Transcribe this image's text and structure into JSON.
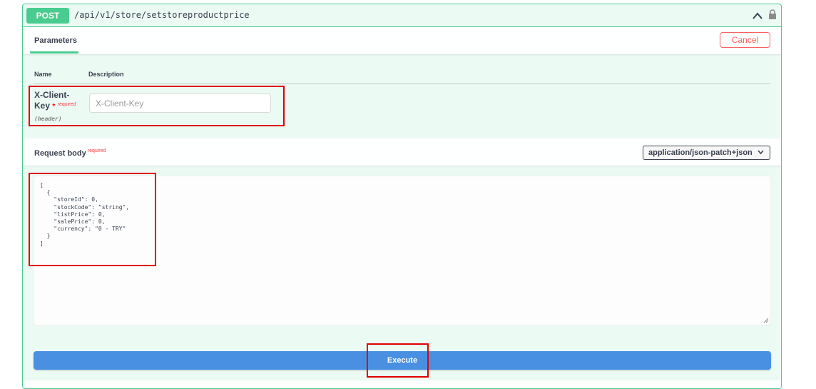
{
  "operation": {
    "method": "POST",
    "path": "/api/v1/store/setstoreproductprice"
  },
  "tabs": {
    "parameters_label": "Parameters",
    "cancel_label": "Cancel"
  },
  "params_table": {
    "headers": {
      "name": "Name",
      "description": "Description"
    },
    "rows": [
      {
        "name": "X-Client-Key",
        "required_star": "*",
        "required_label": "required",
        "location": "(header)",
        "placeholder": "X-Client-Key",
        "value": ""
      }
    ]
  },
  "request_body": {
    "title": "Request body",
    "required_label": "required",
    "content_type": "application/json-patch+json",
    "code": "[\n  {\n    \"storeId\": 0,\n    \"stockCode\": \"string\",\n    \"listPrice\": 0,\n    \"salePrice\": 0,\n    \"currency\": \"0 - TRY\"\n  }\n]"
  },
  "actions": {
    "execute_label": "Execute"
  },
  "colors": {
    "post_green": "#49cc90",
    "execute_blue": "#4990e2",
    "cancel_red": "#ff6060",
    "annotation_red": "#e00000"
  },
  "icons": {
    "collapse": "chevron-up-icon",
    "auth": "lock-icon",
    "select": "chevron-down-icon",
    "resize": "resize-grip-icon"
  }
}
